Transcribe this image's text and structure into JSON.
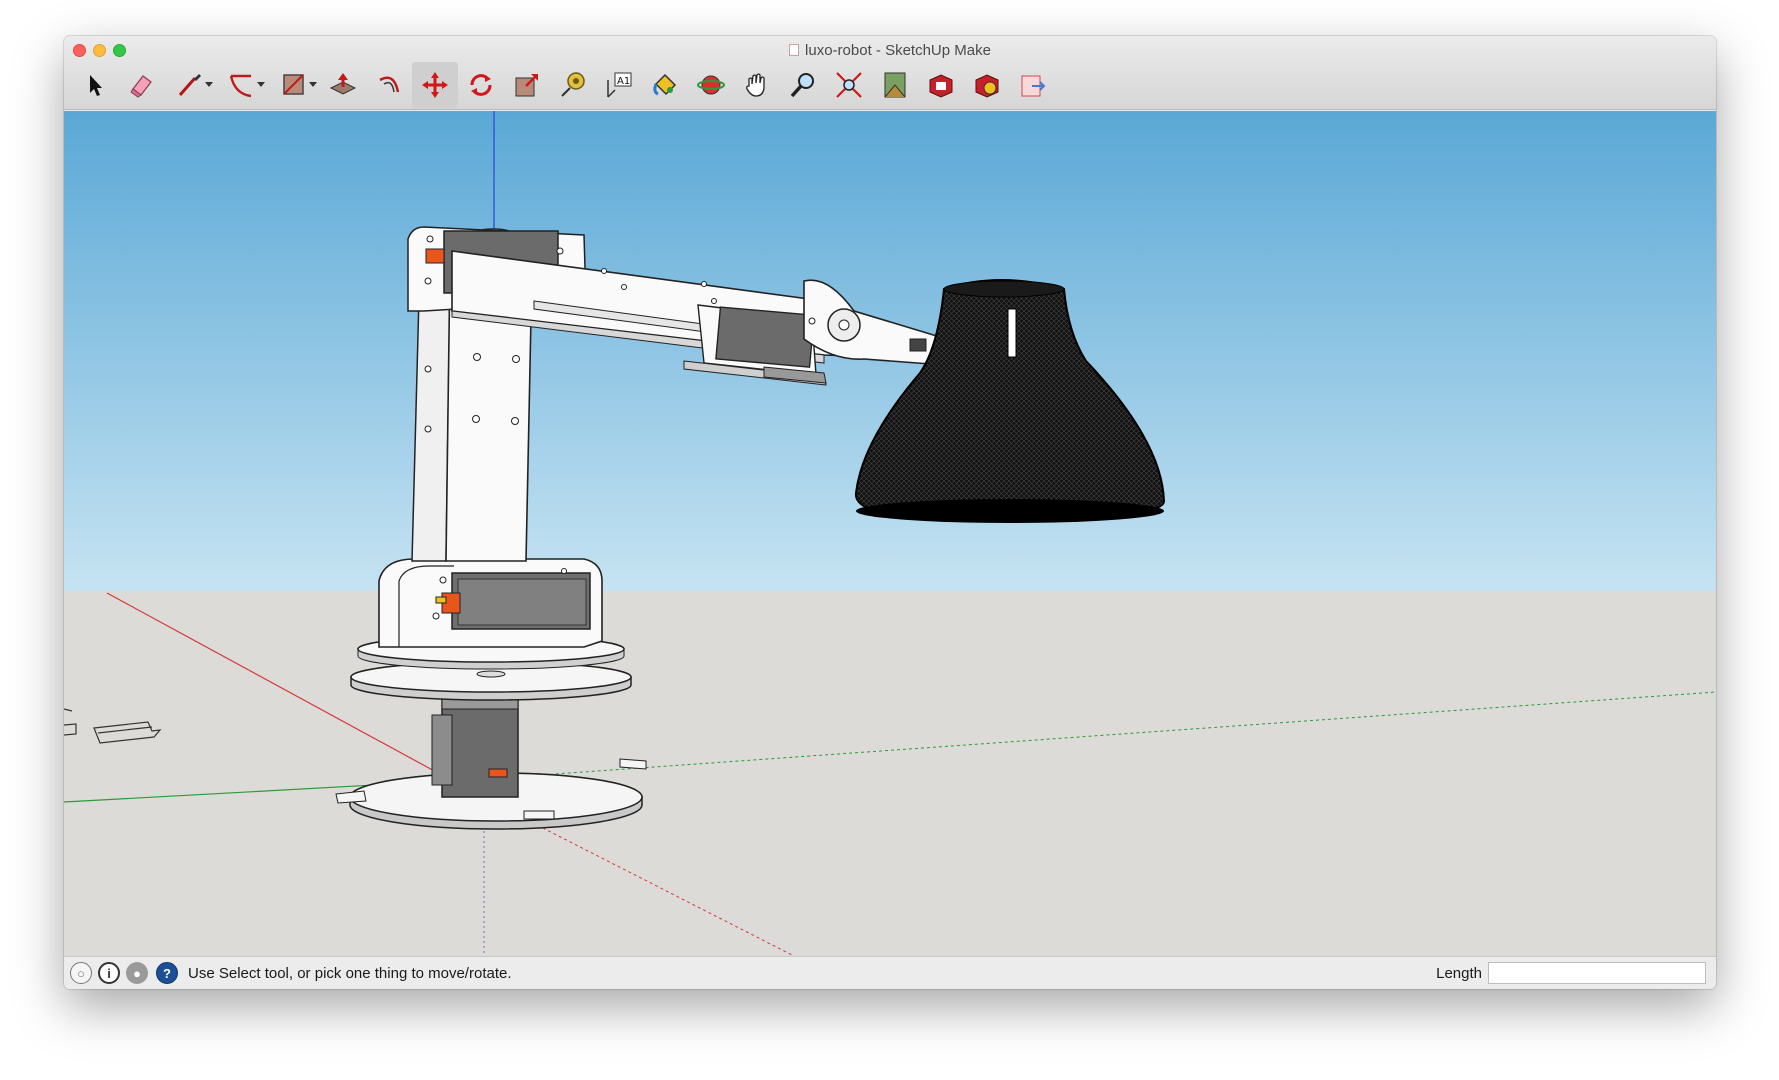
{
  "window": {
    "title": "luxo-robot - SketchUp Make"
  },
  "toolbar": {
    "tools": [
      {
        "name": "select-tool-icon",
        "active": false
      },
      {
        "name": "eraser-tool-icon",
        "active": false
      },
      {
        "name": "line-tool-icon",
        "active": false,
        "dropdown": true
      },
      {
        "name": "arc-tool-icon",
        "active": false,
        "dropdown": true
      },
      {
        "name": "rectangle-tool-icon",
        "active": false,
        "dropdown": true
      },
      {
        "name": "push-pull-tool-icon",
        "active": false
      },
      {
        "name": "offset-tool-icon",
        "active": false
      },
      {
        "name": "move-tool-icon",
        "active": true
      },
      {
        "name": "rotate-tool-icon",
        "active": false
      },
      {
        "name": "scale-tool-icon",
        "active": false
      },
      {
        "name": "tape-measure-tool-icon",
        "active": false
      },
      {
        "name": "text-tool-icon",
        "active": false
      },
      {
        "name": "paint-bucket-tool-icon",
        "active": false
      },
      {
        "name": "orbit-tool-icon",
        "active": false
      },
      {
        "name": "pan-tool-icon",
        "active": false
      },
      {
        "name": "zoom-tool-icon",
        "active": false
      },
      {
        "name": "zoom-extents-tool-icon",
        "active": false
      },
      {
        "name": "warehouse-tool-icon",
        "active": false
      },
      {
        "name": "extension-warehouse-tool-icon",
        "active": false
      },
      {
        "name": "extension-manager-tool-icon",
        "active": false
      },
      {
        "name": "send-to-layout-tool-icon",
        "active": false
      }
    ],
    "text_tool_glyph": "A1"
  },
  "statusbar": {
    "geo_glyph": "○",
    "credits_glyph": "i",
    "user_glyph": "●",
    "help_glyph": "?",
    "message": "Use Select tool, or pick one thing to move/rotate.",
    "measurement_label": "Length",
    "measurement_value": ""
  },
  "colors": {
    "sky_top": "#5aa8d6",
    "sky_bottom": "#c6e3f2",
    "ground": "#dcdbd8",
    "red_axis": "#d33b3b",
    "green_axis": "#2a9a3a",
    "blue_axis": "#2a4fd6",
    "servo_body": "#6b6b6b",
    "servo_accent": "#e8561c"
  }
}
